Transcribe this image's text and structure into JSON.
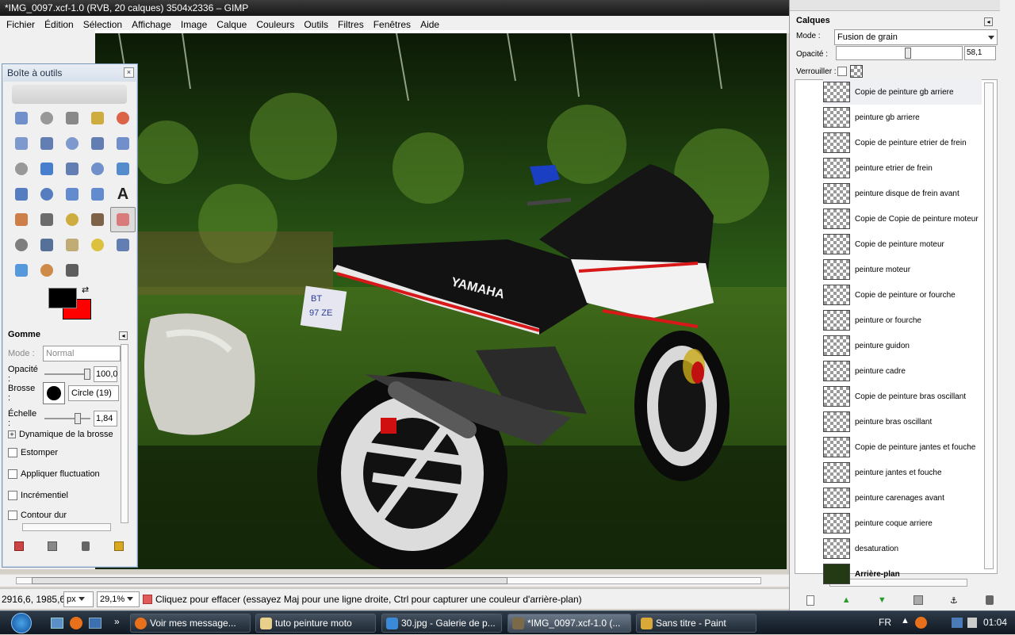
{
  "window": {
    "title": "*IMG_0097.xcf-1.0 (RVB, 20 calques) 3504x2336 – GIMP"
  },
  "menubar": [
    "Fichier",
    "Édition",
    "Sélection",
    "Affichage",
    "Image",
    "Calque",
    "Couleurs",
    "Outils",
    "Filtres",
    "Fenêtres",
    "Aide"
  ],
  "toolbox": {
    "title": "Boîte à outils",
    "tools": [
      "rect-select-icon",
      "ellipse-select-icon",
      "lasso-icon",
      "fuzzy-select-icon",
      "color-select-icon",
      "scissors-icon",
      "foreground-select-icon",
      "paths-icon",
      "color-picker-icon",
      "zoom-icon",
      "measure-icon",
      "move-icon",
      "align-icon",
      "crop-icon",
      "rotate-icon",
      "scale-icon",
      "shear-icon",
      "perspective-icon",
      "flip-icon",
      "text-icon",
      "bucket-fill-icon",
      "gradient-icon",
      "pencil-icon",
      "paintbrush-icon",
      "eraser-icon",
      "airbrush-icon",
      "ink-icon",
      "clone-icon",
      "heal-icon",
      "perspective-clone-icon",
      "blur-icon",
      "smudge-icon",
      "dodge-burn-icon"
    ],
    "active_tool": 24,
    "fg_color": "#000000",
    "bg_color": "#ff0000"
  },
  "tool_options": {
    "title": "Gomme",
    "mode_label": "Mode :",
    "mode_value": "Normal",
    "opacity_label": "Opacité :",
    "opacity_value": "100,0",
    "brush_label": "Brosse :",
    "brush_value": "Circle (19)",
    "scale_label": "Échelle :",
    "scale_value": "1,84",
    "dynamics_label": "Dynamique de la brosse",
    "checks": [
      "Estomper",
      "Appliquer fluctuation",
      "Incrémentiel",
      "Contour dur"
    ]
  },
  "statusbar": {
    "coords": "2916,6, 1985,6",
    "unit": "px",
    "zoom": "29,1%",
    "message": "Cliquez pour effacer (essayez Maj pour une ligne droite, Ctrl pour capturer une couleur d'arrière-plan)"
  },
  "layers": {
    "title": "Calques",
    "mode_label": "Mode :",
    "mode_value": "Fusion de grain",
    "opacity_label": "Opacité :",
    "opacity_value": "58,1",
    "lock_label": "Verrouiller :",
    "items": [
      "Copie de peinture gb arriere",
      "peinture gb arriere",
      "Copie de peinture etrier de frein",
      "peinture etrier de frein",
      "peinture disque de frein avant",
      "Copie de Copie de peinture moteur",
      "Copie de peinture moteur",
      "peinture moteur",
      "Copie de peinture or fourche",
      "peinture or fourche",
      "peinture guidon",
      "peinture cadre",
      "Copie de peinture bras oscillant",
      "peinture bras oscillant",
      "Copie de peinture jantes et fouche",
      "peinture jantes et fouche",
      "peinture carenages avant",
      "peinture coque arriere",
      "desaturation",
      "Arrière-plan"
    ]
  },
  "taskbar": {
    "items": [
      "Voir mes message...",
      "tuto peinture moto",
      "30.jpg - Galerie de p...",
      "*IMG_0097.xcf-1.0 (...",
      "Sans titre - Paint"
    ],
    "lang": "FR",
    "time": "01:04"
  },
  "plate": {
    "line1": "BT",
    "line2": "97 ZE"
  },
  "brand": "YAMAHA"
}
